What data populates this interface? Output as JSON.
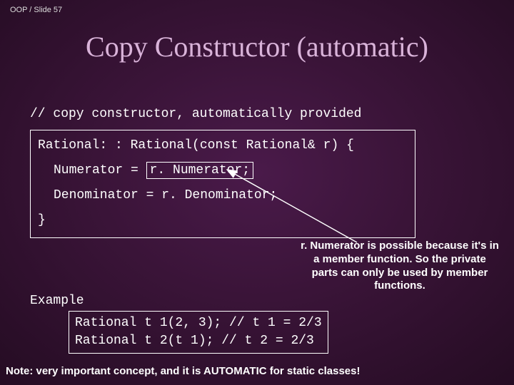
{
  "breadcrumb": "OOP / Slide 57",
  "title": "Copy Constructor (automatic)",
  "code": {
    "comment": "// copy constructor, automatically provided",
    "line1a": "Rational: : Rational(const Rational& r) {",
    "line2a": "Numerator = ",
    "line2box": "r. Numerator;",
    "line3": "Denominator = r. Denominator;",
    "line4": "}"
  },
  "annotation": "r. Numerator is possible because it's in a member function.\nSo the private parts can only be used by member functions.",
  "example": {
    "label": "Example",
    "l1": "Rational t 1(2, 3); // t 1 = 2/3",
    "l2": "Rational t 2(t 1);  // t 2 = 2/3"
  },
  "footnote": "Note: very important concept, and it is AUTOMATIC for static classes!"
}
